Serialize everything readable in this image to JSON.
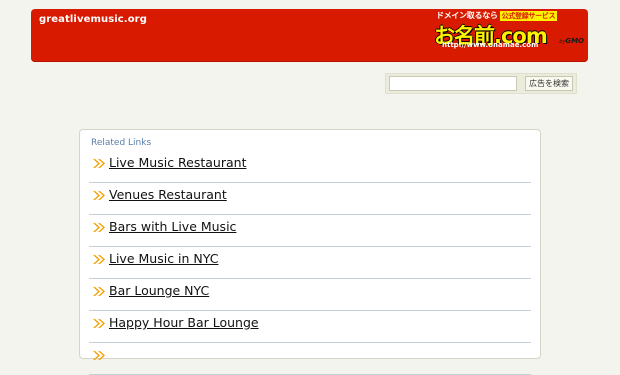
{
  "header": {
    "domain": "greatlivemusic.org"
  },
  "logo": {
    "top_text": "ドメイン取るなら",
    "badge": "公式登録サービス",
    "main": "お名前.com",
    "url": "http://www.onamae.com",
    "brand": "GMO",
    "brand_prefix": "by"
  },
  "search": {
    "value": "",
    "button_label": "広告を検索"
  },
  "related": {
    "title": "Related Links",
    "links": [
      {
        "label": "Live Music Restaurant"
      },
      {
        "label": "Venues Restaurant"
      },
      {
        "label": "Bars with Live Music"
      },
      {
        "label": "Live Music in NYC"
      },
      {
        "label": "Bar Lounge NYC"
      },
      {
        "label": "Happy Hour Bar Lounge"
      }
    ]
  },
  "colors": {
    "header_bg": "#d81b00",
    "arrow": "#f5a000",
    "link_title": "#5a7fa8"
  }
}
